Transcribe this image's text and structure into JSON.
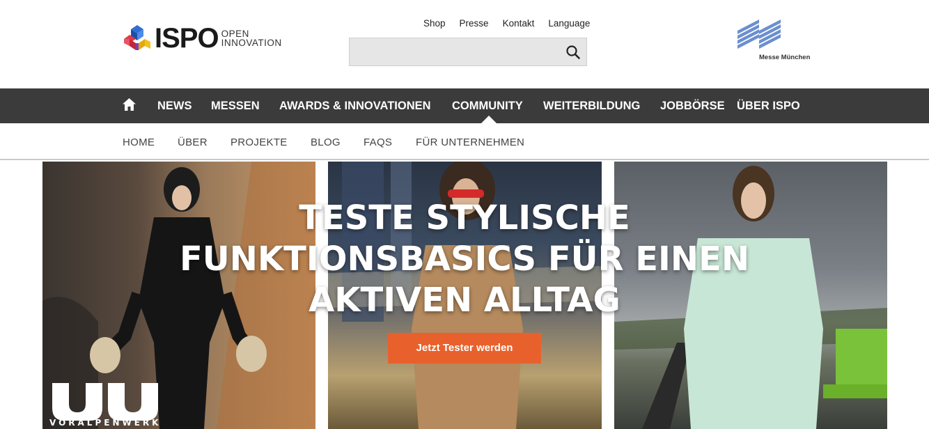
{
  "header": {
    "logo": {
      "wordmark": "ISPO",
      "sub_line1": "OPEN",
      "sub_line2": "INNOVATION"
    },
    "meta_nav": [
      "Shop",
      "Presse",
      "Kontakt",
      "Language"
    ],
    "search": {
      "placeholder": "",
      "value": ""
    },
    "partner_logo": {
      "label": "Messe München"
    }
  },
  "main_nav": {
    "items": [
      "NEWS",
      "MESSEN",
      "AWARDS & INNOVATIONEN",
      "COMMUNITY",
      "WEITERBILDUNG",
      "JOBBÖRSE",
      "ÜBER ISPO"
    ],
    "active": "COMMUNITY"
  },
  "sub_nav": {
    "items": [
      "HOME",
      "ÜBER",
      "PROJEKTE",
      "BLOG",
      "FAQS",
      "FÜR UNTERNEHMEN"
    ]
  },
  "hero": {
    "title_lines": [
      "TESTE STYLISCHE",
      "FUNKTIONSBASICS FÜR EINEN",
      "AKTIVEN ALLTAG"
    ],
    "cta_label": "Jetzt Tester werden",
    "brand_label": "VORALPENWERK"
  },
  "colors": {
    "nav_bg": "#3b3b3b",
    "cta_bg": "#e8612c",
    "search_bg": "#e6e6e6",
    "mm_blue": "#6b8fcf"
  },
  "icons": [
    "ispo-logo-icon",
    "search-icon",
    "messe-muenchen-logo-icon",
    "home-icon"
  ]
}
